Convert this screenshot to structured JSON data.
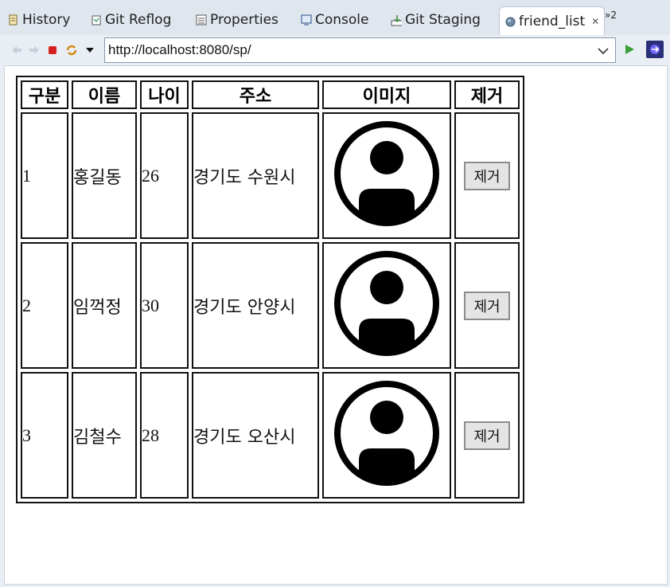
{
  "tabs": [
    {
      "label": "History",
      "icon": "history-icon"
    },
    {
      "label": "Git Reflog",
      "icon": "git-reflog-icon"
    },
    {
      "label": "Properties",
      "icon": "properties-icon"
    },
    {
      "label": "Console",
      "icon": "console-icon"
    },
    {
      "label": "Git Staging",
      "icon": "git-staging-icon"
    },
    {
      "label": "friend_list",
      "icon": "browser-globe-icon"
    }
  ],
  "overflow_label": "»2",
  "address": {
    "url": "http://localhost:8080/sp/"
  },
  "table": {
    "headers": [
      "구분",
      "이름",
      "나이",
      "주소",
      "이미지",
      "제거"
    ],
    "rows": [
      {
        "no": "1",
        "name": "홍길동",
        "age": "26",
        "address": "경기도 수원시",
        "button": "제거"
      },
      {
        "no": "2",
        "name": "임꺽정",
        "age": "30",
        "address": "경기도 안양시",
        "button": "제거"
      },
      {
        "no": "3",
        "name": "김철수",
        "age": "28",
        "address": "경기도 오산시",
        "button": "제거"
      }
    ]
  }
}
